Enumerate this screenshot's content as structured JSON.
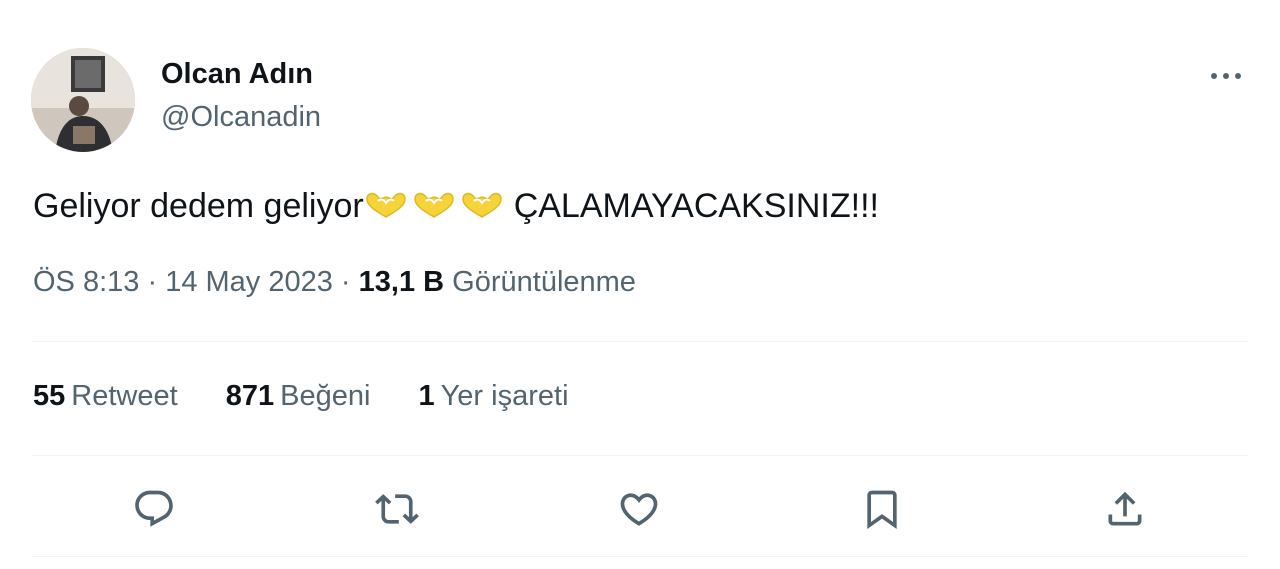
{
  "user": {
    "display_name": "Olcan Adın",
    "handle": "@Olcanadin",
    "avatar_icon": "profile-photo"
  },
  "tweet": {
    "text_before": "Geliyor dedem geliyor",
    "emoji": [
      "heart-hands-emoji",
      "heart-hands-emoji",
      "heart-hands-emoji"
    ],
    "text_after": "ÇALAMAYACAKSINIZ!!!"
  },
  "meta": {
    "time": "ÖS 8:13",
    "sep1": " · ",
    "date": "14 May 2023",
    "sep2": " · ",
    "views_count": "13,1 B",
    "views_label": "Görüntülenme"
  },
  "stats": {
    "retweets": {
      "count": "55",
      "label": "Retweet"
    },
    "likes": {
      "count": "871",
      "label": "Beğeni"
    },
    "bookmarks": {
      "count": "1",
      "label": "Yer işareti"
    }
  },
  "actions": [
    "reply-icon",
    "retweet-icon",
    "like-icon",
    "bookmark-icon",
    "share-icon"
  ],
  "colors": {
    "text": "#0f1419",
    "secondary": "#536471",
    "divider": "#eff3f4",
    "emoji": "#f5d33b"
  }
}
